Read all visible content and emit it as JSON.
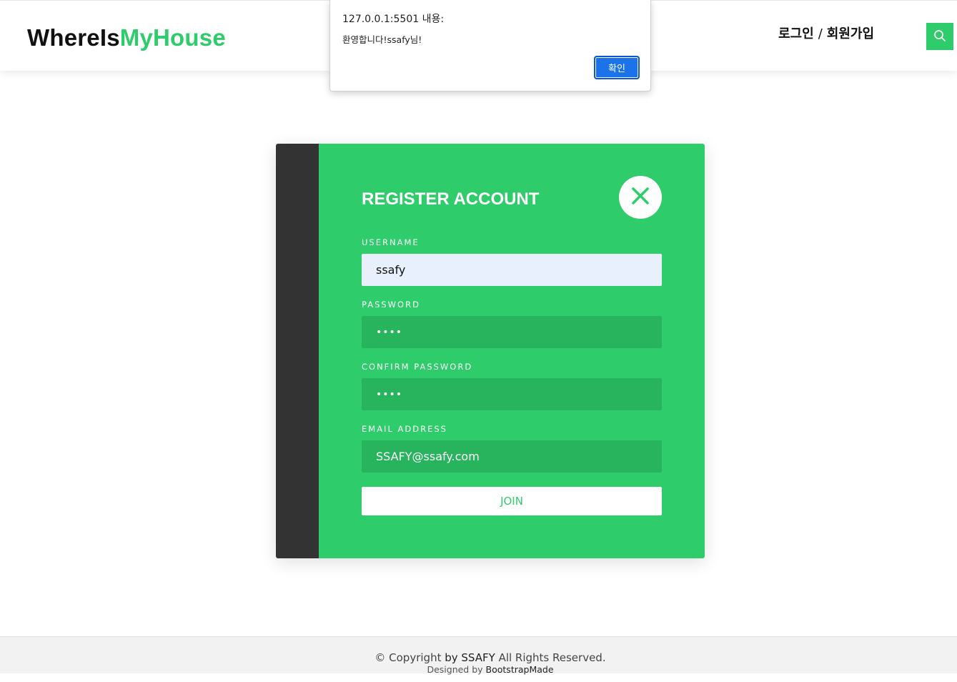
{
  "header": {
    "logo_part1": "WhereIs",
    "logo_part2": "MyHouse",
    "login_label": "로그인",
    "separator": "/",
    "signup_label": "회원가입",
    "search_icon": "search-icon"
  },
  "alert": {
    "title": "127.0.0.1:5501 내용:",
    "message": "환영합니다!ssafy님!",
    "ok_label": "확인"
  },
  "register": {
    "title": "REGISTER ACCOUNT",
    "close_icon": "close-icon",
    "username_label": "USERNAME",
    "username_value": "ssafy",
    "password_label": "PASSWORD",
    "password_value": "••••",
    "confirm_label": "CONFIRM PASSWORD",
    "confirm_value": "••••",
    "email_label": "EMAIL ADDRESS",
    "email_value": "SSAFY@ssafy.com",
    "join_label": "JOIN"
  },
  "footer": {
    "copyright_prefix": "© Copyright",
    "copyright_by": "by SSAFY",
    "copyright_suffix": "All Rights Reserved.",
    "designed_by_prefix": "Designed by",
    "designed_by_name": "BootstrapMade"
  },
  "colors": {
    "brand_green": "#2ecc6a",
    "field_green": "#27b45c",
    "dark_panel": "#333333",
    "dialog_button": "#1a73e8"
  }
}
